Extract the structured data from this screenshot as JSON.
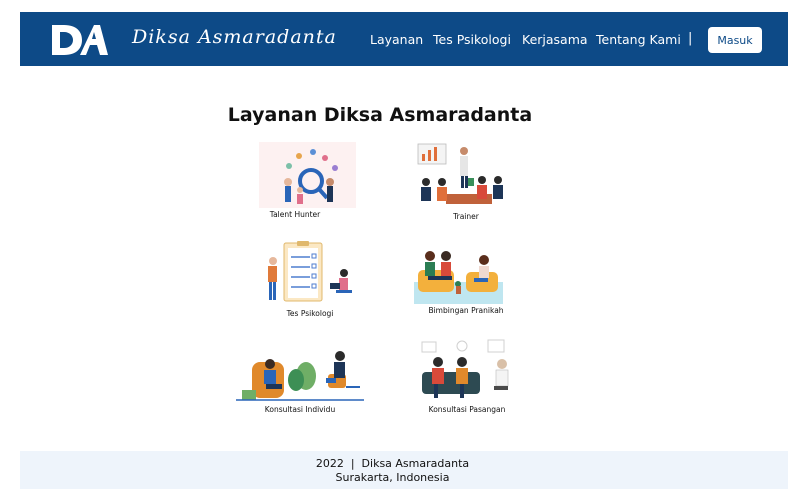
{
  "header": {
    "brand_name": "Diksa Asmaradanta",
    "nav": [
      {
        "label": "Layanan"
      },
      {
        "label": "Tes Psikologi"
      },
      {
        "label": "Kerjasama"
      },
      {
        "label": "Tentang Kami"
      }
    ],
    "separator": "|",
    "login_label": "Masuk"
  },
  "main": {
    "title": "Layanan Diksa Asmaradanta",
    "services": [
      {
        "label": "Talent Hunter",
        "icon": "talent-hunter-illustration"
      },
      {
        "label": "Trainer",
        "icon": "trainer-illustration"
      },
      {
        "label": "Tes Psikologi",
        "icon": "psychology-test-illustration"
      },
      {
        "label": "Bimbingan Pranikah",
        "icon": "premarital-guidance-illustration"
      },
      {
        "label": "Konsultasi Individu",
        "icon": "individual-consultation-illustration"
      },
      {
        "label": "Konsultasi Pasangan",
        "icon": "couple-consultation-illustration"
      }
    ]
  },
  "footer": {
    "line1": "2022  |  Diksa Asmaradanta",
    "line2": "Surakarta, Indonesia"
  },
  "colors": {
    "brand": "#0d4a87",
    "footer_bg": "#eef4fb"
  }
}
